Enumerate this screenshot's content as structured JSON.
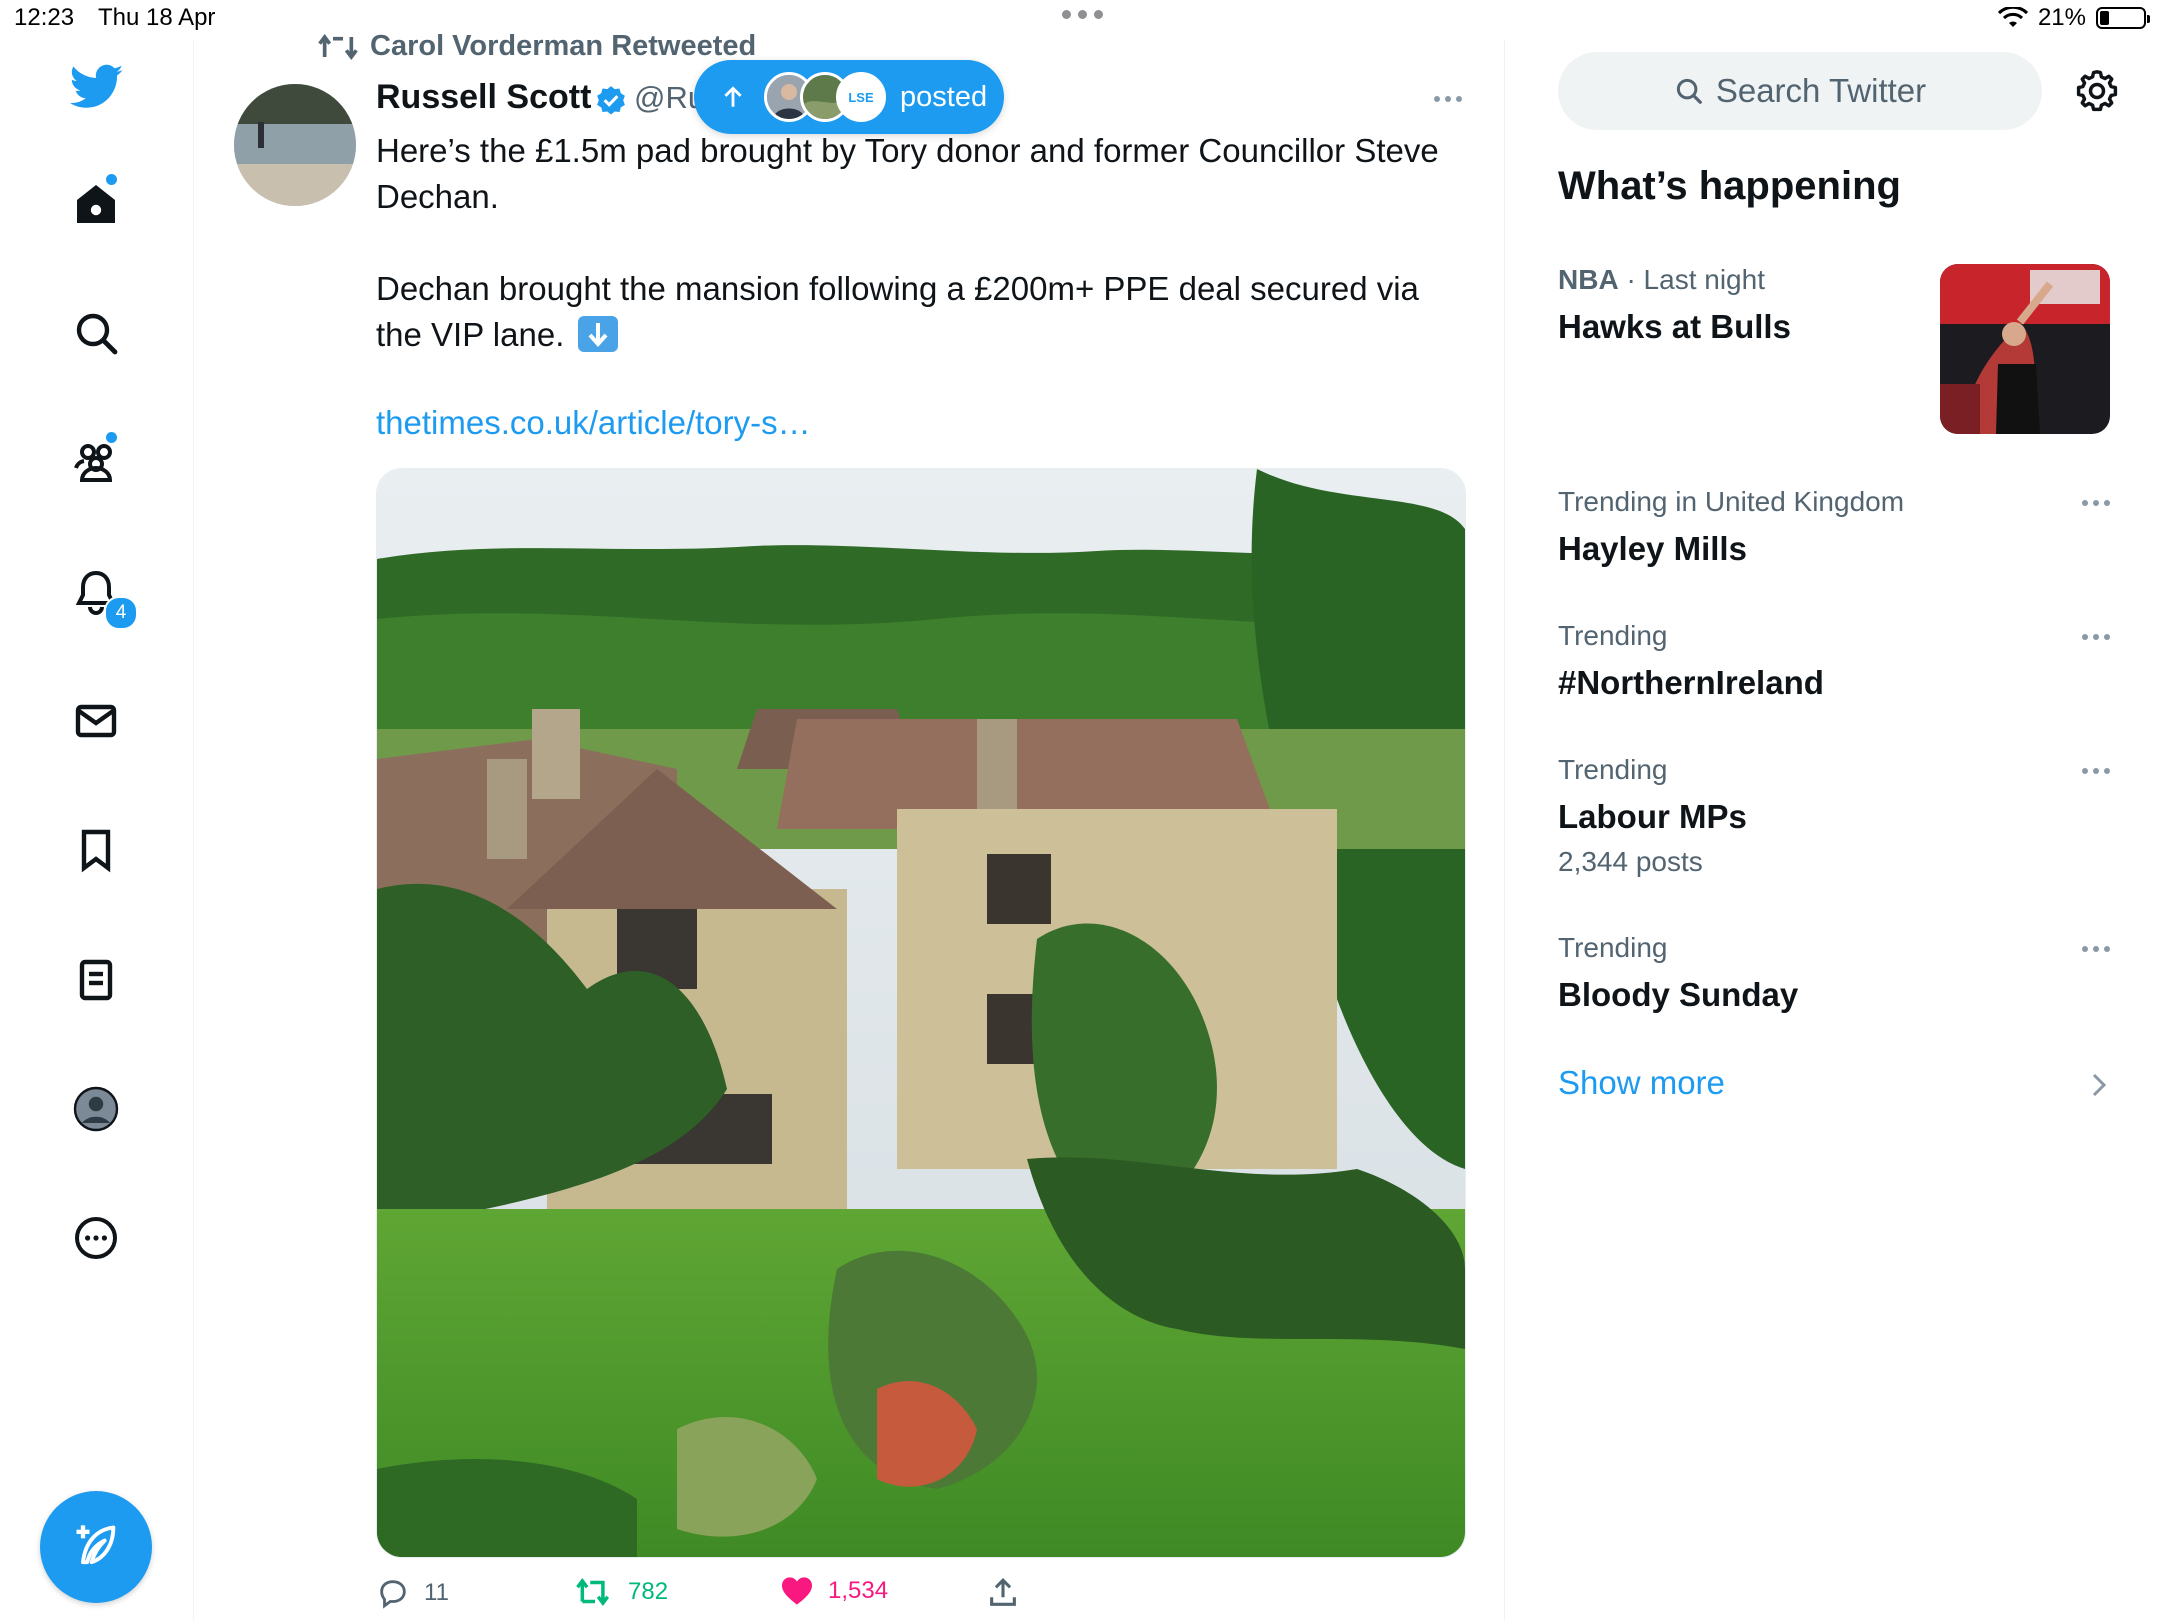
{
  "status_bar": {
    "time": "12:23",
    "date": "Thu 18 Apr",
    "battery": "21%",
    "battery_level": 0.21
  },
  "nav": {
    "items": [
      {
        "name": "home",
        "icon": "home-icon"
      },
      {
        "name": "explore",
        "icon": "search-icon"
      },
      {
        "name": "communities",
        "icon": "communities-icon"
      },
      {
        "name": "notifications",
        "icon": "bell-icon",
        "badge": "4"
      },
      {
        "name": "messages",
        "icon": "mail-icon"
      },
      {
        "name": "bookmarks",
        "icon": "bookmark-icon"
      },
      {
        "name": "lists",
        "icon": "list-icon"
      },
      {
        "name": "profile",
        "icon": "profile-icon"
      },
      {
        "name": "more",
        "icon": "more-circle-icon"
      }
    ],
    "compose_icon": "compose-feather-icon"
  },
  "tweet": {
    "retweeted_by": "Carol Vorderman Retweeted",
    "author_name": "Russell Scott",
    "author_handle": "@Ru",
    "text": "Here’s the £1.5m pad brought by Tory donor and former Councillor Steve Dechan.\n\nDechan brought the mansion following a £200m+ PPE deal secured via the VIP lane.",
    "link": "thetimes.co.uk/article/tory-s…",
    "replies": "11",
    "retweets": "782",
    "likes": "1,534"
  },
  "new_posts_pill": {
    "label": "posted",
    "badge_text": "LSE"
  },
  "sidebar": {
    "search_placeholder": "Search Twitter",
    "heading": "What’s happening",
    "trends": [
      {
        "category": "NBA",
        "meta": " · Last night",
        "title": "Hawks at Bulls",
        "count": ""
      },
      {
        "category": "",
        "meta": "Trending in United Kingdom",
        "title": "Hayley Mills",
        "count": ""
      },
      {
        "category": "",
        "meta": "Trending",
        "title": "#NorthernIreland",
        "count": ""
      },
      {
        "category": "",
        "meta": "Trending",
        "title": "Labour MPs",
        "count": "2,344 posts"
      },
      {
        "category": "",
        "meta": "Trending",
        "title": "Bloody Sunday",
        "count": ""
      }
    ],
    "show_more": "Show more"
  },
  "colors": {
    "accent": "#1d9bf0",
    "retweet": "#00ba7c",
    "like": "#f91880",
    "text": "#0f1419",
    "secondary": "#536471"
  }
}
